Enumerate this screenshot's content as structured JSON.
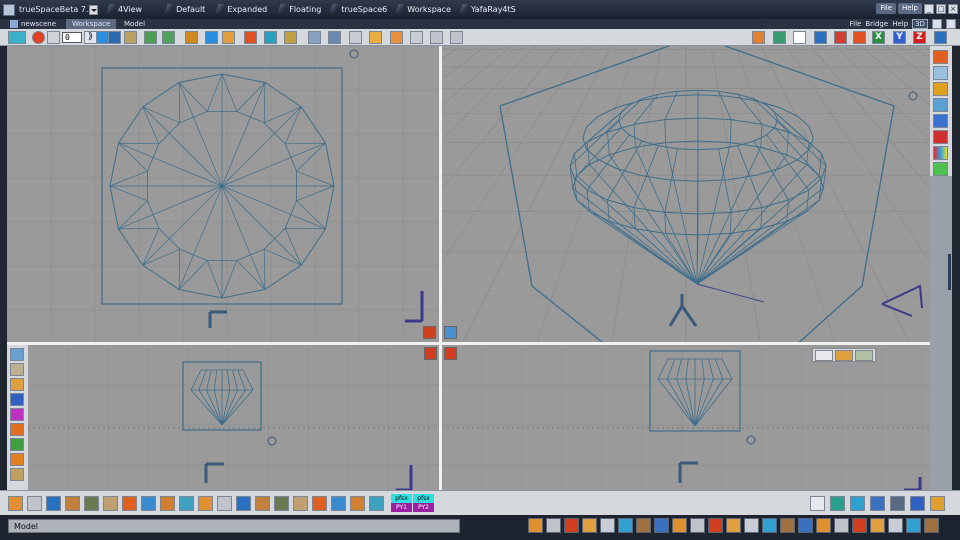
{
  "app": {
    "title": "trueSpaceBeta 7.61",
    "document": "newscene",
    "colors": {
      "wire": "#3d6e8c",
      "viewport_bg": "#9a9a9a",
      "chrome": "#d5d9de",
      "titlebar": "#1f2735"
    }
  },
  "layouts": [
    "4View",
    "Default",
    "Expanded",
    "Floating",
    "trueSpace6",
    "Workspace",
    "YafaRay4tS"
  ],
  "title_menu": {
    "file": "File",
    "help": "Help"
  },
  "window_controls": {
    "minimize": "_",
    "restore": "□",
    "close": "×"
  },
  "tabs": {
    "workspace": "Workspace",
    "model": "Model"
  },
  "secondary_menu": {
    "file": "File",
    "bridge": "Bridge",
    "help": "Help",
    "mode": "3D"
  },
  "toolbar": {
    "frame_value": "0",
    "axis_x": "X",
    "axis_y": "Y",
    "axis_z": "Z"
  },
  "plugins": [
    {
      "top": "pfsx",
      "bottom": "PY1"
    },
    {
      "top": "pfsx",
      "bottom": "PY2"
    }
  ],
  "status": {
    "mode": "Model"
  }
}
